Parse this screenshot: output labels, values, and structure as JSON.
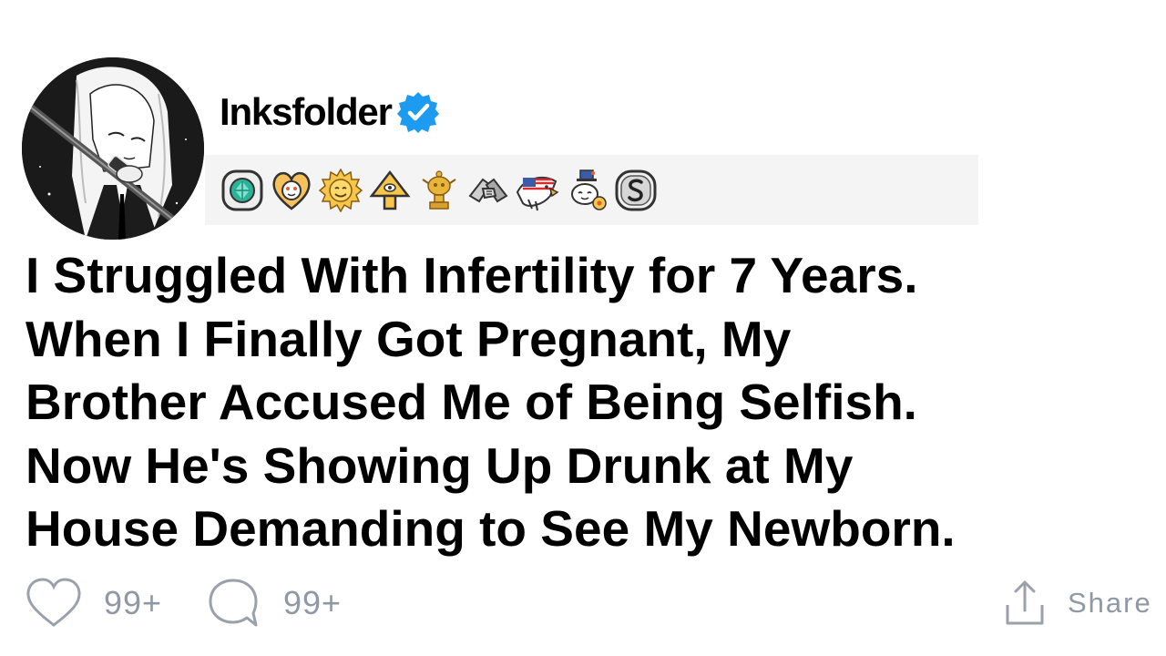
{
  "post": {
    "author": {
      "username": "Inksfolder",
      "verified": true,
      "avatar_icon": "anime-girl-with-katana-avatar"
    },
    "awards": [
      {
        "icon": "diamond-gem-award-icon",
        "color": "#2bb39a"
      },
      {
        "icon": "wholesome-heart-award-icon",
        "color": "#f2b233"
      },
      {
        "icon": "sun-face-award-icon",
        "color": "#f2b233"
      },
      {
        "icon": "pyramid-eye-award-icon",
        "color": "#f2b233"
      },
      {
        "icon": "gold-snoo-trophy-award-icon",
        "color": "#d9a12b"
      },
      {
        "icon": "handshake-award-icon",
        "color": "#9a9a9a"
      },
      {
        "icon": "bald-eagle-flag-award-icon",
        "color": "#3b5ba5"
      },
      {
        "icon": "snoo-top-hat-award-icon",
        "color": "#e35b3a"
      },
      {
        "icon": "silver-s-award-icon",
        "color": "#8c8c8c"
      }
    ],
    "title_lines": [
      "I Struggled With Infertility for 7 Years.",
      "When I Finally Got Pregnant, My",
      "Brother Accused Me of Being Selfish.",
      "Now He's Showing Up Drunk at My",
      "House Demanding to See My Newborn."
    ],
    "actions": {
      "likes": "99+",
      "comments": "99+",
      "share_label": "Share"
    }
  },
  "colors": {
    "verified_badge": "#1d9bf0",
    "action_gray": "#8f98a5",
    "awards_bar_bg": "#f4f4f4"
  }
}
